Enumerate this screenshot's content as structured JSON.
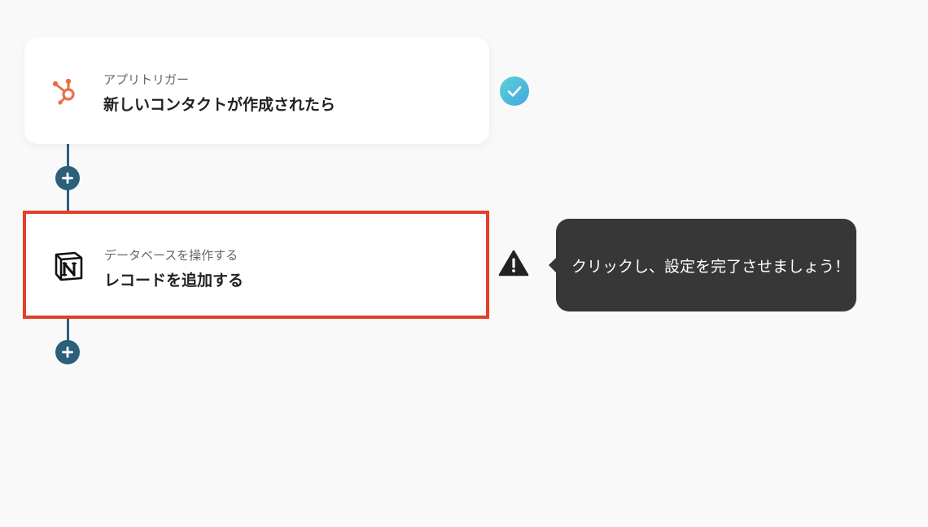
{
  "flow": {
    "trigger": {
      "caption": "アプリトリガー",
      "title": "新しいコンタクトが作成されたら",
      "icon": "hubspot-icon",
      "status": "complete"
    },
    "action": {
      "caption": "データベースを操作する",
      "title": "レコードを追加する",
      "icon": "notion-icon",
      "status": "warning"
    }
  },
  "tooltip": {
    "text": "クリックし、設定を完了させましょう！"
  },
  "colors": {
    "background": "#f9f9f9",
    "connector": "#2b5f7a",
    "highlight_border": "#e04128",
    "check_gradient_start": "#5fd0d8",
    "check_gradient_end": "#3fa7e0",
    "tooltip_bg": "#373737",
    "hubspot": "#e8704a"
  },
  "icons": {
    "add": "plus-icon",
    "check": "check-icon",
    "warning": "warning-icon"
  }
}
